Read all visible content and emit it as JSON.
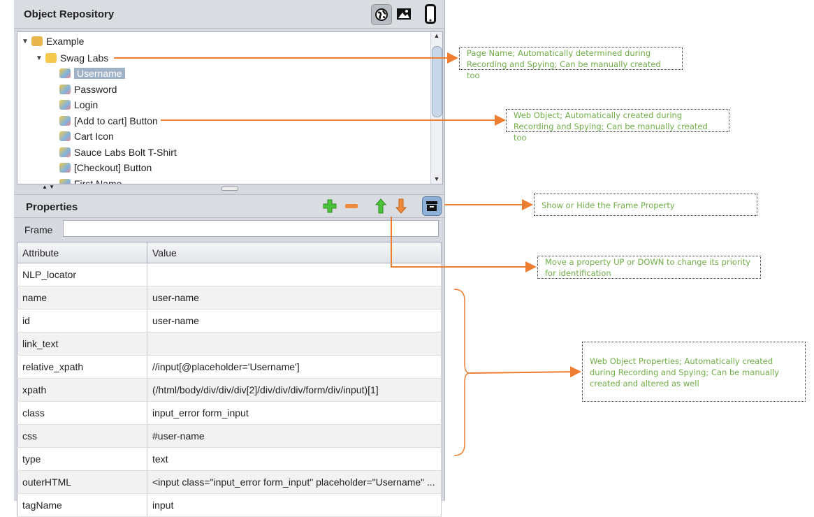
{
  "header": {
    "title": "Object Repository",
    "icons": [
      "globe-icon",
      "image-icon",
      "mobile-icon"
    ]
  },
  "tree": {
    "root": "Example",
    "page": "Swag Labs",
    "items": [
      "Username",
      "Password",
      "Login",
      "[Add to cart] Button",
      "Cart Icon",
      "Sauce Labs Bolt T-Shirt",
      "[Checkout] Button",
      "First Name"
    ],
    "selected": "Username"
  },
  "properties": {
    "title": "Properties",
    "frame_label": "Frame",
    "frame_value": "",
    "columns": [
      "Attribute",
      "Value"
    ],
    "rows": [
      [
        "NLP_locator",
        ""
      ],
      [
        "name",
        "user-name"
      ],
      [
        "id",
        "user-name"
      ],
      [
        "link_text",
        ""
      ],
      [
        "relative_xpath",
        "//input[@placeholder='Username']"
      ],
      [
        "xpath",
        "(/html/body/div/div/div[2]/div/div/div/form/div/input)[1]"
      ],
      [
        "class",
        "input_error form_input"
      ],
      [
        "css",
        "#user-name"
      ],
      [
        "type",
        "text"
      ],
      [
        "outerHTML",
        "<input class=\"input_error form_input\" placeholder=\"Username\" ..."
      ],
      [
        "tagName",
        "input"
      ]
    ]
  },
  "annotations": {
    "page_name": "Page Name; Automatically determined during Recording and Spying; Can be manually created too",
    "web_object": "Web Object; Automatically created during Recording and Spying; Can be manually created too",
    "frame_toggle": "Show or Hide the Frame Property",
    "move": "Move a property UP or DOWN to change its priority for identification",
    "props": "Web Object Properties; Automatically created during Recording and Spying; Can be manually created and altered as well"
  },
  "colors": {
    "annotation_text": "#70ad47",
    "arrow": "#ed7d31",
    "selection": "#9fb1c6"
  }
}
